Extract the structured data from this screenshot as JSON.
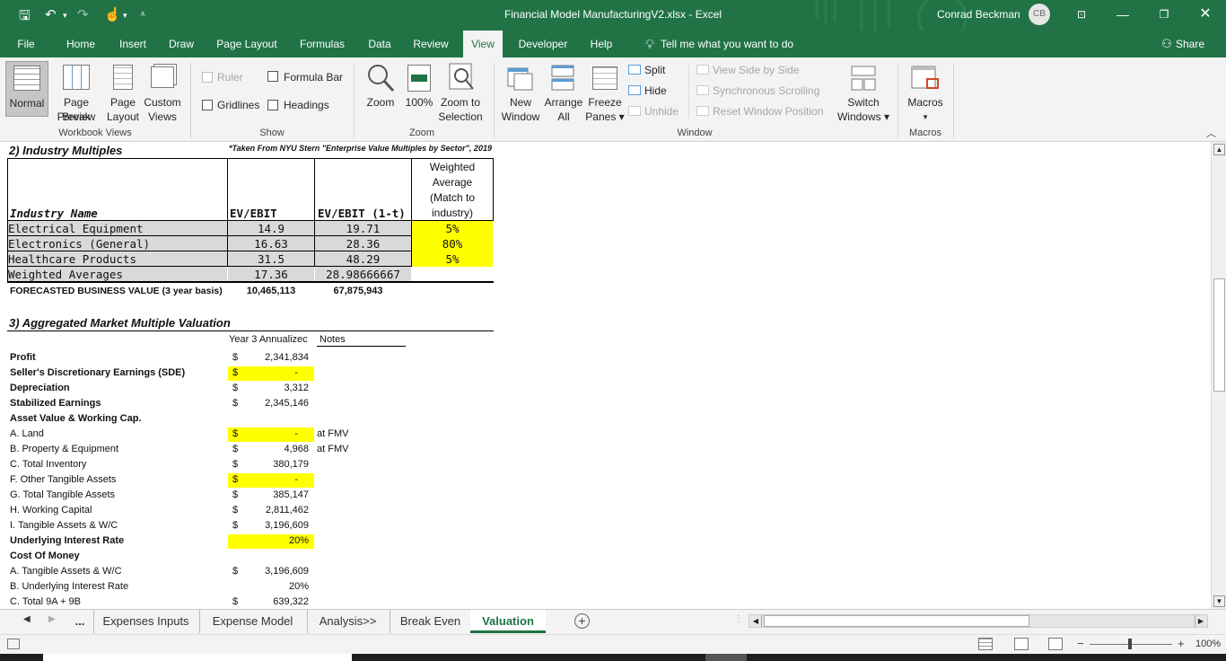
{
  "window": {
    "title": "Financial Model ManufacturingV2.xlsx  -  Excel",
    "user": "Conrad Beckman",
    "avatar": "CB",
    "share": "Share"
  },
  "tabs": [
    "File",
    "Home",
    "Insert",
    "Draw",
    "Page Layout",
    "Formulas",
    "Data",
    "Review",
    "View",
    "Developer",
    "Help"
  ],
  "active_tab": "View",
  "tell_me": "Tell me what you want to do",
  "ribbon": {
    "normal": "Normal",
    "page_break": "Page Break",
    "page_break2": "Preview",
    "page_layout": "Page",
    "page_layout2": "Layout",
    "custom_views": "Custom",
    "custom_views2": "Views",
    "group_workbook_views": "Workbook Views",
    "ruler": "Ruler",
    "formula_bar": "Formula Bar",
    "gridlines": "Gridlines",
    "headings": "Headings",
    "group_show": "Show",
    "zoom": "Zoom",
    "zoom100": "100%",
    "zoom_sel": "Zoom to",
    "zoom_sel2": "Selection",
    "group_zoom": "Zoom",
    "new_window": "New",
    "new_window2": "Window",
    "arrange_all": "Arrange",
    "arrange_all2": "All",
    "freeze": "Freeze",
    "freeze2": "Panes ▾",
    "split": "Split",
    "hide": "Hide",
    "unhide": "Unhide",
    "side_by_side": "View Side by Side",
    "sync_scroll": "Synchronous Scrolling",
    "reset_pos": "Reset Window Position",
    "switch_windows": "Switch",
    "switch_windows2": "Windows ▾",
    "group_window": "Window",
    "macros": "Macros",
    "macros_arrow": "▾",
    "group_macros": "Macros"
  },
  "sheet": {
    "sec2_title": "2) Industry Multiples",
    "source_note": "*Taken From NYU Stern \"Enterprise Value Multiples by Sector\", 2019",
    "hdr_industry": "Industry Name",
    "hdr_evebit": "EV/EBIT",
    "hdr_evebit1t": "EV/EBIT (1-t)",
    "hdr_weighted": [
      "Weighted",
      "Average",
      "(Match to",
      "industry)"
    ],
    "rows": [
      {
        "name": "Electrical Equipment",
        "evebit": "14.9",
        "evebit1t": "19.71",
        "weight": "5%"
      },
      {
        "name": "Electronics (General)",
        "evebit": "16.63",
        "evebit1t": "28.36",
        "weight": "80%"
      },
      {
        "name": "Healthcare Products",
        "evebit": "31.5",
        "evebit1t": "48.29",
        "weight": "5%"
      },
      {
        "name": "Weighted Averages",
        "evebit": "17.36",
        "evebit1t": "28.98666667",
        "weight": ""
      }
    ],
    "forecast_label": "FORECASTED BUSINESS VALUE (3 year basis)",
    "forecast_evebit": "10,465,113",
    "forecast_evebit1t": "67,875,943",
    "sec3_title": "3) Aggregated Market Multiple Valuation",
    "col_year3": "Year 3 Annualizec",
    "col_notes": "Notes",
    "items": [
      {
        "label": "Profit",
        "bold": true,
        "cur": "$",
        "val": "2,341,834",
        "note": "",
        "yellow": false
      },
      {
        "label": "Seller's Discretionary Earnings (SDE)",
        "bold": true,
        "cur": "$",
        "val": "-",
        "note": "",
        "yellow": true
      },
      {
        "label": "Depreciation",
        "bold": true,
        "cur": "$",
        "val": "3,312",
        "note": "",
        "yellow": false
      },
      {
        "label": "Stabilized Earnings",
        "bold": true,
        "cur": "$",
        "val": "2,345,146",
        "note": "",
        "yellow": false
      },
      {
        "label": "Asset Value & Working Cap.",
        "bold": true,
        "cur": "",
        "val": "",
        "note": "",
        "yellow": false
      },
      {
        "label": "A. Land",
        "bold": false,
        "cur": "$",
        "val": "-",
        "note": "at FMV",
        "yellow": true
      },
      {
        "label": "B. Property & Equipment",
        "bold": false,
        "cur": "$",
        "val": "4,968",
        "note": "at FMV",
        "yellow": false
      },
      {
        "label": "C. Total Inventory",
        "bold": false,
        "cur": "$",
        "val": "380,179",
        "note": "",
        "yellow": false
      },
      {
        "label": "F. Other Tangible Assets",
        "bold": false,
        "cur": "$",
        "val": "-",
        "note": "",
        "yellow": true
      },
      {
        "label": "G. Total Tangible Assets",
        "bold": false,
        "cur": "$",
        "val": "385,147",
        "note": "",
        "yellow": false
      },
      {
        "label": "H. Working Capital",
        "bold": false,
        "cur": "$",
        "val": "2,811,462",
        "note": "",
        "yellow": false
      },
      {
        "label": "I. Tangible Assets & W/C",
        "bold": false,
        "cur": "$",
        "val": "3,196,609",
        "note": "",
        "yellow": false
      },
      {
        "label": "Underlying Interest Rate",
        "bold": true,
        "cur": "",
        "val": "20%",
        "note": "",
        "yellow": true
      },
      {
        "label": "Cost Of Money",
        "bold": true,
        "cur": "",
        "val": "",
        "note": "",
        "yellow": false
      },
      {
        "label": "A. Tangible Assets & W/C",
        "bold": false,
        "cur": "$",
        "val": "3,196,609",
        "note": "",
        "yellow": false
      },
      {
        "label": "B. Underlying Interest Rate",
        "bold": false,
        "cur": "",
        "val": "20%",
        "note": "",
        "yellow": false
      },
      {
        "label": "C. Total 9A + 9B",
        "bold": false,
        "cur": "$",
        "val": "639,322",
        "note": "",
        "yellow": false
      }
    ]
  },
  "sheet_tabs": [
    "...",
    "Expenses Inputs",
    "Expense Model",
    "Analysis>>",
    "Break Even",
    "Valuation"
  ],
  "active_sheet": "Valuation",
  "status": {
    "zoom": "100%"
  },
  "colors": {
    "excel_green": "#217346",
    "highlight": "#ffff00",
    "grey_fill": "#d9d9d9"
  }
}
